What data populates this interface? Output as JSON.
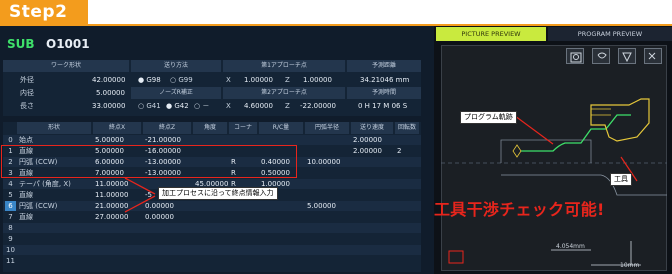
{
  "step": {
    "label": "Step2"
  },
  "program": {
    "mode": "SUB",
    "number": "O1001"
  },
  "header_table": {
    "col_workpiece": "ワーク形状",
    "col_machining": "送り方法",
    "col_approach1": "第1アプローチ点",
    "col_total": "予測距離",
    "rows": [
      {
        "label": "外径",
        "value": "42.00000",
        "opt1": "G98",
        "opt2": "G99",
        "ax1": "X",
        "v1": "1.00000",
        "ax2": "Z",
        "v2": "1.00000",
        "right": "34.21046 mm"
      },
      {
        "label": "内径",
        "value": "5.00000",
        "mid_label": "ノーズR補正",
        "mid_label2": "第2アプローチ点",
        "right_label": "予測時間"
      },
      {
        "label": "長さ",
        "value": "33.00000",
        "opt1": "G41",
        "opt2": "G42",
        "opt3": "－",
        "ax1": "X",
        "v1": "4.60000",
        "ax2": "Z",
        "v2": "-22.00000",
        "right": "0 H 17 M 06 S"
      }
    ]
  },
  "main_table": {
    "headers": [
      "形状",
      "終点X",
      "終点Z",
      "角度",
      "コーナ",
      "R/C量",
      "円弧半径",
      "送り速度",
      "回転数"
    ],
    "rows": [
      {
        "no": "0",
        "shape": "始点",
        "x": "5.00000",
        "z": "-21.00000",
        "angle": "",
        "corner": "",
        "rc": "",
        "radius": "",
        "feed": "2.00000",
        "rpm": ""
      },
      {
        "no": "1",
        "shape": "直線",
        "x": "5.00000",
        "z": "-16.00000",
        "angle": "",
        "corner": "",
        "rc": "",
        "radius": "",
        "feed": "2.00000",
        "rpm": "2"
      },
      {
        "no": "2",
        "shape": "円弧 (CCW)",
        "x": "6.00000",
        "z": "-13.00000",
        "angle": "",
        "corner": "R",
        "rc": "0.40000",
        "radius": "10.00000",
        "feed": "",
        "rpm": ""
      },
      {
        "no": "3",
        "shape": "直線",
        "x": "7.00000",
        "z": "-13.00000",
        "angle": "",
        "corner": "R",
        "rc": "0.50000",
        "radius": "",
        "feed": "",
        "rpm": ""
      },
      {
        "no": "4",
        "shape": "テーパ (角度, X)",
        "x": "11.00000",
        "z": "",
        "angle": "45.00000",
        "corner": "R",
        "rc": "1.00000",
        "radius": "",
        "feed": "",
        "rpm": ""
      },
      {
        "no": "5",
        "shape": "直線",
        "x": "11.00000",
        "z": "-5",
        "angle": "",
        "corner": "",
        "rc": "",
        "radius": "",
        "feed": "",
        "rpm": ""
      },
      {
        "no": "6",
        "shape": "円弧 (CCW)",
        "x": "21.00000",
        "z": "0.00000",
        "angle": "",
        "corner": "",
        "rc": "",
        "radius": "5.00000",
        "feed": "",
        "rpm": ""
      },
      {
        "no": "7",
        "shape": "直線",
        "x": "27.00000",
        "z": "0.00000",
        "angle": "",
        "corner": "",
        "rc": "",
        "radius": "",
        "feed": "",
        "rpm": ""
      },
      {
        "no": "8",
        "shape": "",
        "x": "",
        "z": "",
        "angle": "",
        "corner": "",
        "rc": "",
        "radius": "",
        "feed": "",
        "rpm": ""
      },
      {
        "no": "9",
        "shape": "",
        "x": "",
        "z": "",
        "angle": "",
        "corner": "",
        "rc": "",
        "radius": "",
        "feed": "",
        "rpm": ""
      },
      {
        "no": "10",
        "shape": "",
        "x": "",
        "z": "",
        "angle": "",
        "corner": "",
        "rc": "",
        "radius": "",
        "feed": "",
        "rpm": ""
      },
      {
        "no": "11",
        "shape": "",
        "x": "",
        "z": "",
        "angle": "",
        "corner": "",
        "rc": "",
        "radius": "",
        "feed": "",
        "rpm": ""
      }
    ]
  },
  "annotations": {
    "process_callout": "加工プロセスに沿って終点情報入力",
    "path_callout": "プログラム軌跡",
    "tool_callout": "工具",
    "interference": "工具干渉チェック可能!"
  },
  "preview": {
    "tab_picture": "PICTURE PREVIEW",
    "tab_program": "PROGRAM PREVIEW",
    "scale_h": "4.054mm",
    "scale_v": "10mm",
    "tools": [
      "zoom-fit-icon",
      "rotate-icon",
      "view-icon",
      "settings-icon"
    ]
  },
  "colors": {
    "accent_orange": "#f39c1d",
    "tab_active": "#c9ea3e",
    "highlight": "#e8251c",
    "path_green": "#3ee06a"
  }
}
